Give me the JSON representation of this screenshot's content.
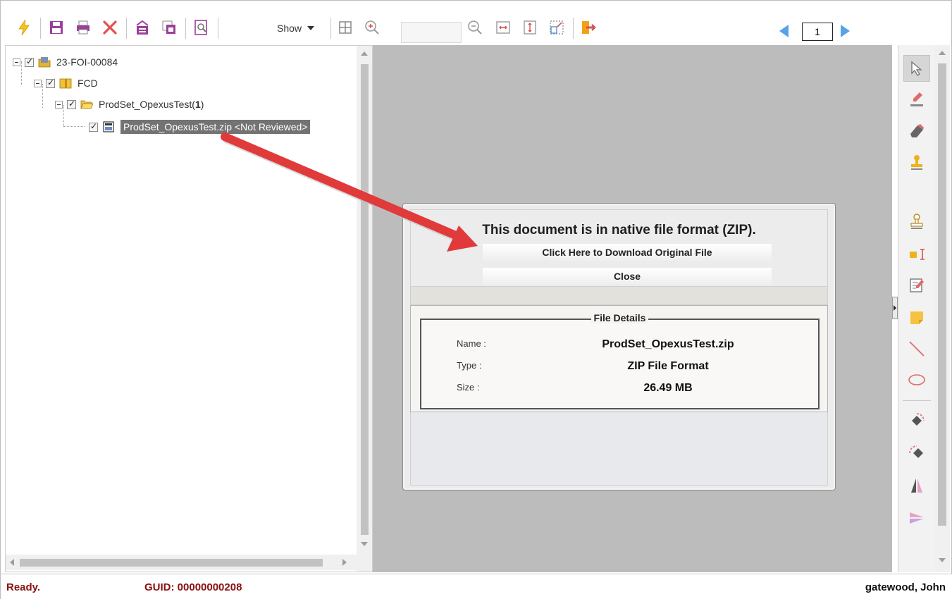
{
  "toolbar": {
    "show_label": "Show",
    "zoom_value": "",
    "page_number": "1",
    "icons": [
      "lightning-icon",
      "save-icon",
      "print-icon",
      "delete-icon",
      "redact-icon",
      "copy-icon",
      "search-document-icon",
      "grid-icon",
      "zoom-in-icon",
      "zoom-out-icon",
      "fit-width-icon",
      "fit-page-icon",
      "actual-size-icon",
      "exit-icon",
      "previous-page-icon",
      "next-page-icon"
    ]
  },
  "tree": {
    "root": {
      "label": "23-FOI-00084",
      "icon": "case-folder-icon"
    },
    "level1": {
      "label": "FCD",
      "icon": "package-icon"
    },
    "level2": {
      "label": "ProdSet_OpexusTest(",
      "count": "1",
      "suffix": ")",
      "icon": "open-folder-icon"
    },
    "level3": {
      "label": "ProdSet_OpexusTest.zip <Not Reviewed>",
      "icon": "document-icon"
    }
  },
  "dialog": {
    "title": "This document is in native file format (ZIP).",
    "download_label": "Click Here to Download Original File",
    "close_label": "Close",
    "details_legend": "File Details",
    "details": [
      {
        "label": "Name :",
        "value": "ProdSet_OpexusTest.zip"
      },
      {
        "label": "Type :",
        "value": "ZIP File Format"
      },
      {
        "label": "Size :",
        "value": "26.49 MB"
      }
    ]
  },
  "right_tools": [
    "select-arrow-icon",
    "highlighter-icon",
    "eraser-icon",
    "stamp-icon",
    "stamp-outline-icon",
    "text-cursor-icon",
    "note-edit-icon",
    "sticky-note-icon",
    "line-icon",
    "ellipse-icon",
    "rotate-left-icon",
    "rotate-right-icon",
    "flip-vertical-icon",
    "flip-horizontal-icon"
  ],
  "status": {
    "state": "Ready.",
    "guid": "GUID: 00000000208",
    "user": "gatewood, John"
  },
  "colors": {
    "status_red": "#8a1010",
    "arrow_red": "#e03a3a",
    "selection_gray": "#737373",
    "nav_blue": "#5aa2e6"
  }
}
